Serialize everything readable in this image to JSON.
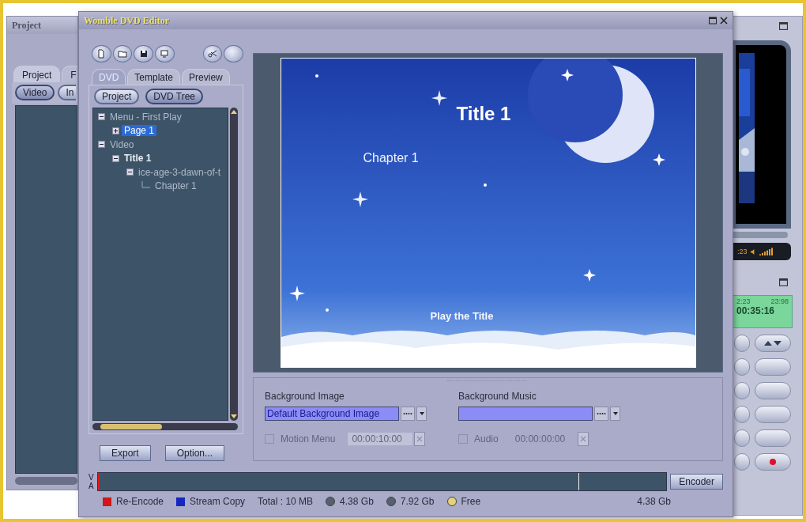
{
  "back_left_window": {
    "title": "Project",
    "tabs": [
      {
        "label": "Project",
        "selected": true
      },
      {
        "label": "F",
        "selected": false
      }
    ],
    "buttons": [
      {
        "label": "Video",
        "selected": true
      },
      {
        "label": "In",
        "selected": false
      }
    ]
  },
  "back_right_window": {
    "player_time": ":23",
    "lcd": {
      "top_left": "2:23",
      "top_right": "23:98",
      "time": "00:35:16"
    }
  },
  "window": {
    "title": "Womble DVD Editor"
  },
  "tabs": [
    {
      "label": "DVD",
      "selected": true
    },
    {
      "label": "Template",
      "selected": false
    },
    {
      "label": "Preview",
      "selected": false
    }
  ],
  "view_buttons": [
    {
      "label": "Project",
      "selected": false
    },
    {
      "label": "DVD Tree",
      "selected": true
    }
  ],
  "tree": [
    {
      "label": "Menu - First Play",
      "kind": "item",
      "expanded": true,
      "selected": false,
      "children": [
        {
          "label": "Page 1",
          "kind": "item",
          "expanded": false,
          "selected": true
        }
      ]
    },
    {
      "label": "Video",
      "kind": "item",
      "expanded": true,
      "selected": false,
      "children": [
        {
          "label": "Title 1",
          "kind": "title",
          "expanded": true,
          "selected": false,
          "children": [
            {
              "label": "ice-age-3-dawn-of-t",
              "kind": "item",
              "expanded": true,
              "selected": false,
              "children": [
                {
                  "label": "Chapter 1",
                  "kind": "item",
                  "selected": false
                }
              ]
            }
          ]
        }
      ]
    }
  ],
  "preview": {
    "title": "Title 1",
    "chapter": "Chapter 1",
    "play_button": "Play the Title"
  },
  "properties": {
    "background_image": {
      "label": "Background Image",
      "value": "Default Background Image"
    },
    "background_music": {
      "label": "Background Music"
    },
    "motion_menu": {
      "label": "Motion Menu",
      "checked": false,
      "disabled": true,
      "duration": "00:00:10:00"
    },
    "audio": {
      "label": "Audio",
      "checked": false,
      "disabled": true,
      "duration": "00:00:00:00"
    }
  },
  "buttons": [
    "Export",
    "Option..."
  ],
  "timeline": {
    "tracks": [
      "V",
      "A"
    ],
    "button": "Encoder"
  },
  "status_bar": {
    "legend": [
      {
        "label": "Re-Encode",
        "color": "#d01818"
      },
      {
        "label": "Stream Copy",
        "color": "#1428c0"
      }
    ],
    "total": "Total : 10 MB",
    "disks": [
      {
        "label": "4.38 Gb",
        "color": "#566070"
      },
      {
        "label": "7.92 Gb",
        "color": "#566070"
      },
      {
        "label": "Free",
        "color": "#e6d27a"
      }
    ],
    "free_size": "4.38 Gb"
  }
}
